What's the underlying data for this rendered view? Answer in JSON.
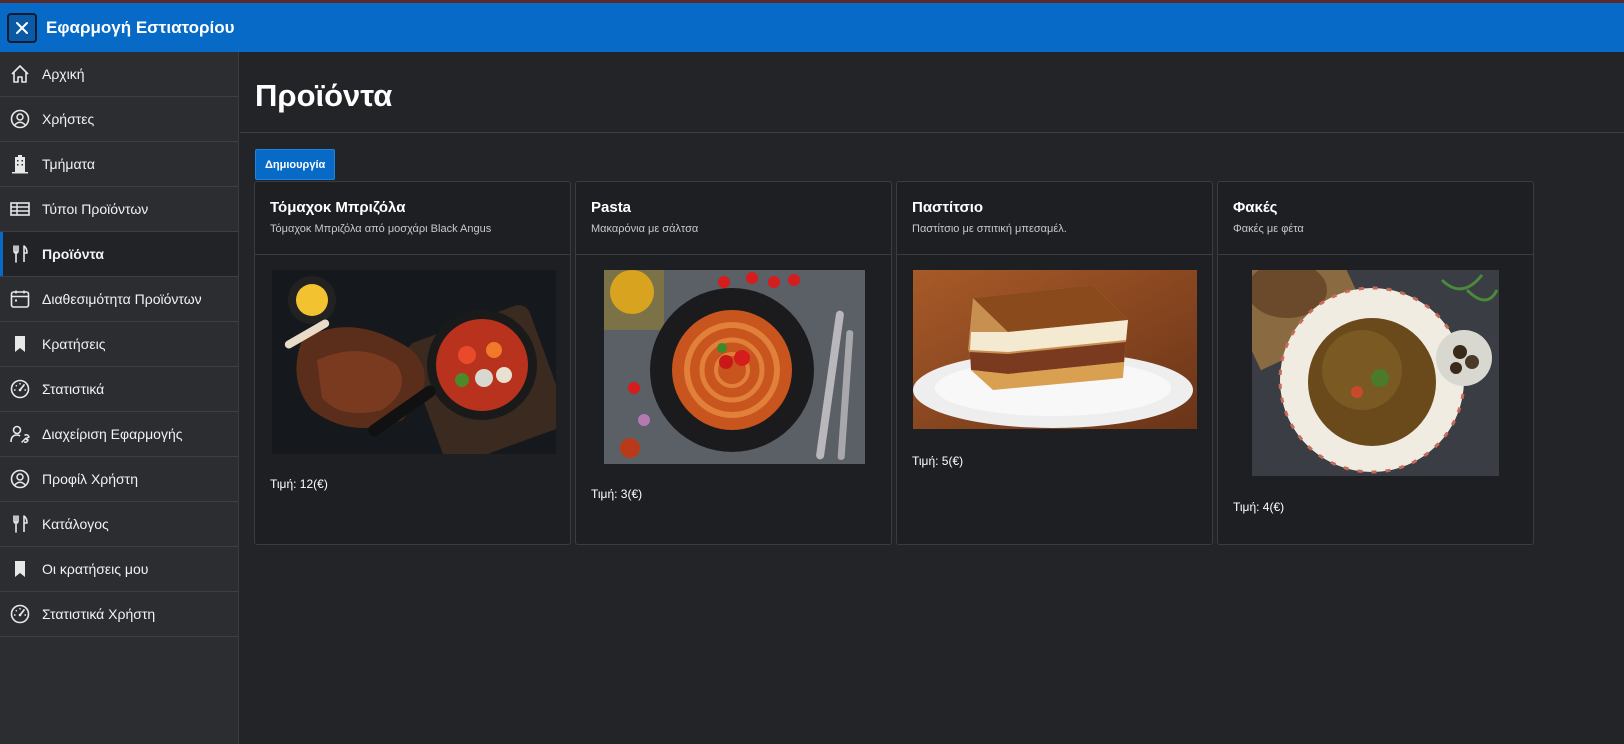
{
  "app": {
    "title": "Εφαρμογή Εστιατορίου"
  },
  "sidebar": {
    "items": [
      {
        "label": "Αρχική",
        "icon": "home-icon",
        "active": false
      },
      {
        "label": "Χρήστες",
        "icon": "user-circle-icon",
        "active": false
      },
      {
        "label": "Τμήματα",
        "icon": "building-icon",
        "active": false
      },
      {
        "label": "Τύποι Προϊόντων",
        "icon": "table-icon",
        "active": false
      },
      {
        "label": "Προϊόντα",
        "icon": "fork-knife-icon",
        "active": true
      },
      {
        "label": "Διαθεσιμότητα Προϊόντων",
        "icon": "calendar-icon",
        "active": false
      },
      {
        "label": "Κρατήσεις",
        "icon": "bookmark-icon",
        "active": false
      },
      {
        "label": "Στατιστικά",
        "icon": "gauge-icon",
        "active": false
      },
      {
        "label": "Διαχείριση Εφαρμογής",
        "icon": "user-wrench-icon",
        "active": false
      },
      {
        "label": "Προφίλ Χρήστη",
        "icon": "user-circle-icon",
        "active": false
      },
      {
        "label": "Κατάλογος",
        "icon": "fork-knife-icon",
        "active": false
      },
      {
        "label": "Οι κρατήσεις μου",
        "icon": "bookmark-icon",
        "active": false
      },
      {
        "label": "Στατιστικά Χρήστη",
        "icon": "gauge-icon",
        "active": false
      }
    ]
  },
  "main": {
    "title": "Προϊόντα",
    "create_label": "Δημιουργία",
    "products": [
      {
        "name": "Τόμαχοκ Μπριζόλα",
        "description": "Τόμαχοκ Μπριζόλα από μοσχάρι Black Angus",
        "price": "Τιμή: 12(€)",
        "image": "steak-photo"
      },
      {
        "name": "Pasta",
        "description": "Μακαρόνια με σάλτσα",
        "price": "Τιμή: 3(€)",
        "image": "pasta-photo"
      },
      {
        "name": "Παστίτσιο",
        "description": "Παστίτσιο με σπιτική μπεσαμέλ.",
        "price": "Τιμή: 5(€)",
        "image": "pastitsio-photo"
      },
      {
        "name": "Φακές",
        "description": "Φακές με φέτα",
        "price": "Τιμή: 4(€)",
        "image": "lentils-photo"
      }
    ]
  },
  "colors": {
    "header": "#066ac6",
    "sidebar": "#2b2d31",
    "content": "#232427",
    "card": "#1e1f22"
  }
}
